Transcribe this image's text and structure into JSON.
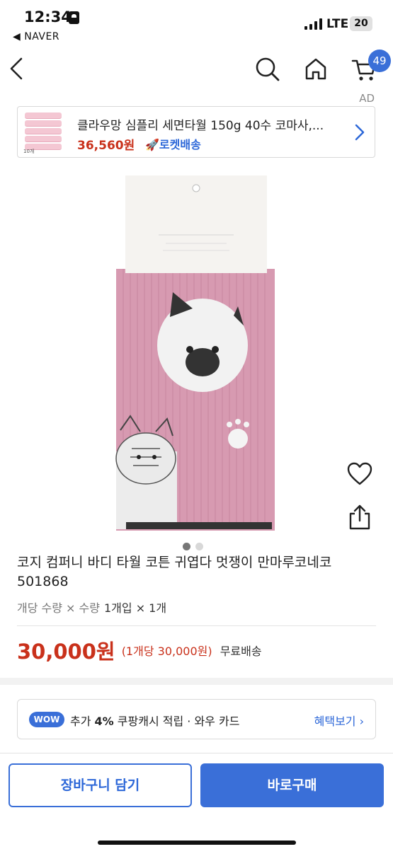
{
  "status_bar": {
    "time": "12:34",
    "back_app": "◀ NAVER",
    "network": "LTE",
    "battery": "20"
  },
  "nav": {
    "cart_count": "49"
  },
  "ad": {
    "label": "AD",
    "title": "클라우망 심플리 세면타월 150g 40수 코마사,...",
    "price": "36,560원",
    "delivery": "🚀로켓배송",
    "thumb_qty": "10개"
  },
  "product": {
    "title": "코지 컴퍼니 바디 타월 코튼 귀엽다 멋쟁이 만마루코네코 501868",
    "option_label": "개당 수량 × 수량",
    "option_value": "1개입 × 1개",
    "price": "30,000원",
    "unit_price": "(1개당 30,000원)",
    "shipping": "무료배송",
    "image_count": 2,
    "current_image": 1
  },
  "wow": {
    "pill": "WOW",
    "text_prefix": "추가 ",
    "percent": "4%",
    "text_suffix": " 쿠팡캐시 적립 · 와우 카드",
    "link": "혜택보기 ›"
  },
  "actions": {
    "add_to_cart": "장바구니 담기",
    "buy_now": "바로구매"
  },
  "colors": {
    "accent": "#3a6fd8",
    "price": "#c9311b",
    "towel_pink": "#d79ab1"
  }
}
